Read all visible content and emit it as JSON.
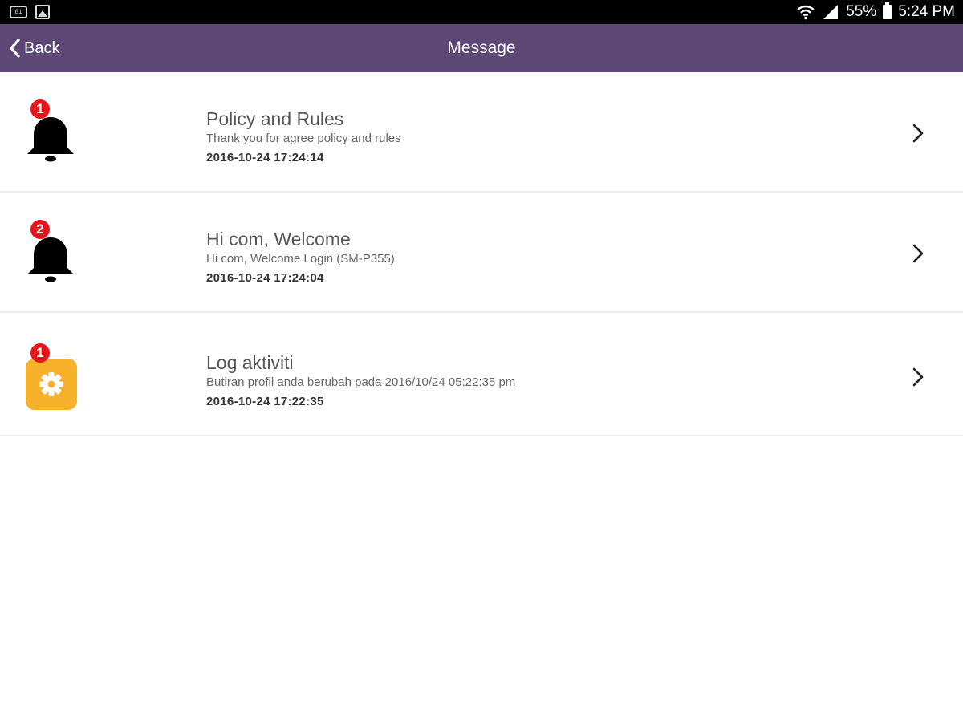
{
  "status_bar": {
    "left_icon_label": "61",
    "battery_percent": "55%",
    "time": "5:24 PM"
  },
  "header": {
    "back_label": "Back",
    "title": "Message",
    "bg_color": "#5c4775"
  },
  "messages": [
    {
      "icon": "bell-icon",
      "badge": "1",
      "title": "Policy and Rules",
      "subtitle": "Thank you for agree policy and rules",
      "timestamp": "2016-10-24 17:24:14"
    },
    {
      "icon": "bell-icon",
      "badge": "2",
      "title": "Hi com, Welcome",
      "subtitle": "Hi com, Welcome Login (SM-P355)",
      "timestamp": "2016-10-24 17:24:04"
    },
    {
      "icon": "gear-icon",
      "badge": "1",
      "title": "Log aktiviti",
      "subtitle": "Butiran profil anda berubah pada 2016/10/24 05:22:35 pm",
      "timestamp": "2016-10-24 17:22:35"
    }
  ],
  "colors": {
    "badge": "#e8141b",
    "settings_tile": "#f7b12b"
  }
}
